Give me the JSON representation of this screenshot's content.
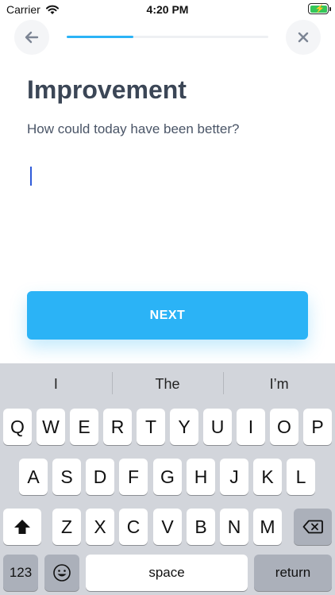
{
  "status_bar": {
    "carrier": "Carrier",
    "time": "4:20 PM"
  },
  "header": {
    "back_icon": "arrow-left-icon",
    "close_icon": "close-icon",
    "progress": 0.33
  },
  "title": "Improvement",
  "subtitle": "How could today have been better?",
  "answer": {
    "value": "",
    "placeholder": ""
  },
  "next_label": "NEXT",
  "keyboard": {
    "predictions": [
      "I",
      "The",
      "I’m"
    ],
    "row1": [
      "Q",
      "W",
      "E",
      "R",
      "T",
      "Y",
      "U",
      "I",
      "O",
      "P"
    ],
    "row2": [
      "A",
      "S",
      "D",
      "F",
      "G",
      "H",
      "J",
      "K",
      "L"
    ],
    "row3": [
      "Z",
      "X",
      "C",
      "V",
      "B",
      "N",
      "M"
    ],
    "shift_icon": "shift-icon",
    "delete_icon": "delete-icon",
    "numbers_label": "123",
    "emoji_icon": "emoji-icon",
    "space_label": "space",
    "return_label": "return"
  },
  "colors": {
    "accent": "#2bb3f6",
    "caret": "#2f5bd9",
    "title": "#3b4656",
    "battery": "#34c759"
  }
}
